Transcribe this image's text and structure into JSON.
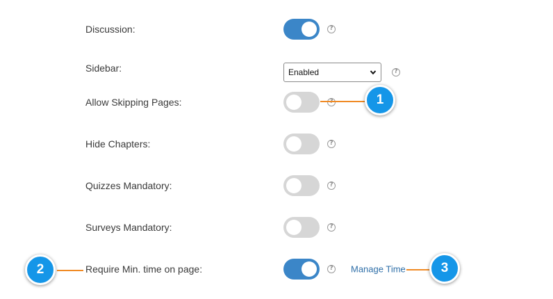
{
  "settings": [
    {
      "label": "Discussion:",
      "type": "toggle",
      "on": true
    },
    {
      "label": "Sidebar:",
      "type": "select",
      "value": "Enabled"
    },
    {
      "label": "Allow Skipping Pages:",
      "type": "toggle",
      "on": false
    },
    {
      "label": "Hide Chapters:",
      "type": "toggle",
      "on": false
    },
    {
      "label": "Quizzes Mandatory:",
      "type": "toggle",
      "on": false
    },
    {
      "label": "Surveys Mandatory:",
      "type": "toggle",
      "on": false
    },
    {
      "label": "Require Min. time on page:",
      "type": "toggle",
      "on": true,
      "link": "Manage Time"
    }
  ],
  "help_glyph": "?",
  "callouts": [
    "1",
    "2",
    "3"
  ],
  "colors": {
    "toggle_on": "#3b86c8",
    "toggle_off": "#d6d6d6",
    "callout_badge": "#1596e8",
    "callout_line": "#f08a24",
    "link": "#2f6fa8"
  },
  "icons": [
    "help-icon",
    "chevron-down-icon"
  ]
}
